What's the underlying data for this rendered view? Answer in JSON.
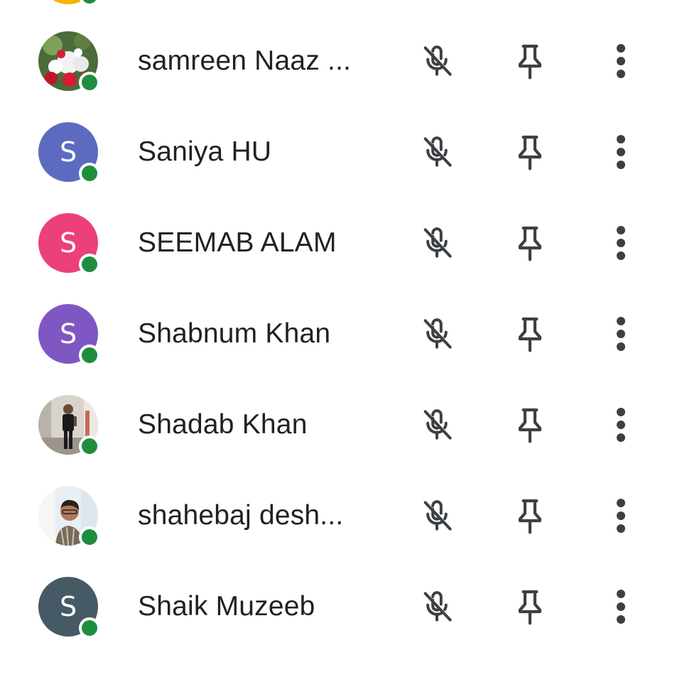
{
  "participants": [
    {
      "name": "samreen Naaz ...",
      "avatar_type": "photo",
      "avatar_photo": "flowers",
      "online": true
    },
    {
      "name": "Saniya HU",
      "avatar_type": "letter",
      "initial": "S",
      "avatar_color": "#5c6bc0",
      "online": true
    },
    {
      "name": "SEEMAB ALAM",
      "avatar_type": "letter",
      "initial": "S",
      "avatar_color": "#ec407a",
      "online": true
    },
    {
      "name": "Shabnum Khan",
      "avatar_type": "letter",
      "initial": "S",
      "avatar_color": "#7e57c2",
      "online": true
    },
    {
      "name": "Shadab Khan",
      "avatar_type": "photo",
      "avatar_photo": "person-standing",
      "online": true
    },
    {
      "name": "shahebaj desh...",
      "avatar_type": "photo",
      "avatar_photo": "person-portrait",
      "online": true
    },
    {
      "name": "Shaik Muzeeb",
      "avatar_type": "letter",
      "initial": "S",
      "avatar_color": "#455a64",
      "online": true
    }
  ],
  "icons": {
    "mic": "mic-off-icon",
    "pin": "pin-icon",
    "more": "more-vert-icon"
  },
  "colors": {
    "presence": "#1e8e3e",
    "text": "#202124",
    "icon": "#3c4043",
    "partial_avatar": "#f4b400"
  }
}
